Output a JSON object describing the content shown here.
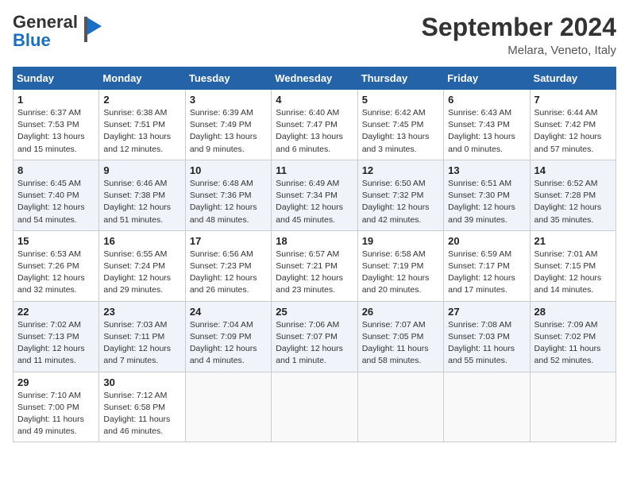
{
  "header": {
    "logo_general": "General",
    "logo_blue": "Blue",
    "month_title": "September 2024",
    "location": "Melara, Veneto, Italy"
  },
  "days_of_week": [
    "Sunday",
    "Monday",
    "Tuesday",
    "Wednesday",
    "Thursday",
    "Friday",
    "Saturday"
  ],
  "weeks": [
    [
      {
        "day": "1",
        "info": "Sunrise: 6:37 AM\nSunset: 7:53 PM\nDaylight: 13 hours\nand 15 minutes."
      },
      {
        "day": "2",
        "info": "Sunrise: 6:38 AM\nSunset: 7:51 PM\nDaylight: 13 hours\nand 12 minutes."
      },
      {
        "day": "3",
        "info": "Sunrise: 6:39 AM\nSunset: 7:49 PM\nDaylight: 13 hours\nand 9 minutes."
      },
      {
        "day": "4",
        "info": "Sunrise: 6:40 AM\nSunset: 7:47 PM\nDaylight: 13 hours\nand 6 minutes."
      },
      {
        "day": "5",
        "info": "Sunrise: 6:42 AM\nSunset: 7:45 PM\nDaylight: 13 hours\nand 3 minutes."
      },
      {
        "day": "6",
        "info": "Sunrise: 6:43 AM\nSunset: 7:43 PM\nDaylight: 13 hours\nand 0 minutes."
      },
      {
        "day": "7",
        "info": "Sunrise: 6:44 AM\nSunset: 7:42 PM\nDaylight: 12 hours\nand 57 minutes."
      }
    ],
    [
      {
        "day": "8",
        "info": "Sunrise: 6:45 AM\nSunset: 7:40 PM\nDaylight: 12 hours\nand 54 minutes."
      },
      {
        "day": "9",
        "info": "Sunrise: 6:46 AM\nSunset: 7:38 PM\nDaylight: 12 hours\nand 51 minutes."
      },
      {
        "day": "10",
        "info": "Sunrise: 6:48 AM\nSunset: 7:36 PM\nDaylight: 12 hours\nand 48 minutes."
      },
      {
        "day": "11",
        "info": "Sunrise: 6:49 AM\nSunset: 7:34 PM\nDaylight: 12 hours\nand 45 minutes."
      },
      {
        "day": "12",
        "info": "Sunrise: 6:50 AM\nSunset: 7:32 PM\nDaylight: 12 hours\nand 42 minutes."
      },
      {
        "day": "13",
        "info": "Sunrise: 6:51 AM\nSunset: 7:30 PM\nDaylight: 12 hours\nand 39 minutes."
      },
      {
        "day": "14",
        "info": "Sunrise: 6:52 AM\nSunset: 7:28 PM\nDaylight: 12 hours\nand 35 minutes."
      }
    ],
    [
      {
        "day": "15",
        "info": "Sunrise: 6:53 AM\nSunset: 7:26 PM\nDaylight: 12 hours\nand 32 minutes."
      },
      {
        "day": "16",
        "info": "Sunrise: 6:55 AM\nSunset: 7:24 PM\nDaylight: 12 hours\nand 29 minutes."
      },
      {
        "day": "17",
        "info": "Sunrise: 6:56 AM\nSunset: 7:23 PM\nDaylight: 12 hours\nand 26 minutes."
      },
      {
        "day": "18",
        "info": "Sunrise: 6:57 AM\nSunset: 7:21 PM\nDaylight: 12 hours\nand 23 minutes."
      },
      {
        "day": "19",
        "info": "Sunrise: 6:58 AM\nSunset: 7:19 PM\nDaylight: 12 hours\nand 20 minutes."
      },
      {
        "day": "20",
        "info": "Sunrise: 6:59 AM\nSunset: 7:17 PM\nDaylight: 12 hours\nand 17 minutes."
      },
      {
        "day": "21",
        "info": "Sunrise: 7:01 AM\nSunset: 7:15 PM\nDaylight: 12 hours\nand 14 minutes."
      }
    ],
    [
      {
        "day": "22",
        "info": "Sunrise: 7:02 AM\nSunset: 7:13 PM\nDaylight: 12 hours\nand 11 minutes."
      },
      {
        "day": "23",
        "info": "Sunrise: 7:03 AM\nSunset: 7:11 PM\nDaylight: 12 hours\nand 7 minutes."
      },
      {
        "day": "24",
        "info": "Sunrise: 7:04 AM\nSunset: 7:09 PM\nDaylight: 12 hours\nand 4 minutes."
      },
      {
        "day": "25",
        "info": "Sunrise: 7:06 AM\nSunset: 7:07 PM\nDaylight: 12 hours\nand 1 minute."
      },
      {
        "day": "26",
        "info": "Sunrise: 7:07 AM\nSunset: 7:05 PM\nDaylight: 11 hours\nand 58 minutes."
      },
      {
        "day": "27",
        "info": "Sunrise: 7:08 AM\nSunset: 7:03 PM\nDaylight: 11 hours\nand 55 minutes."
      },
      {
        "day": "28",
        "info": "Sunrise: 7:09 AM\nSunset: 7:02 PM\nDaylight: 11 hours\nand 52 minutes."
      }
    ],
    [
      {
        "day": "29",
        "info": "Sunrise: 7:10 AM\nSunset: 7:00 PM\nDaylight: 11 hours\nand 49 minutes."
      },
      {
        "day": "30",
        "info": "Sunrise: 7:12 AM\nSunset: 6:58 PM\nDaylight: 11 hours\nand 46 minutes."
      },
      {
        "day": "",
        "info": ""
      },
      {
        "day": "",
        "info": ""
      },
      {
        "day": "",
        "info": ""
      },
      {
        "day": "",
        "info": ""
      },
      {
        "day": "",
        "info": ""
      }
    ]
  ]
}
